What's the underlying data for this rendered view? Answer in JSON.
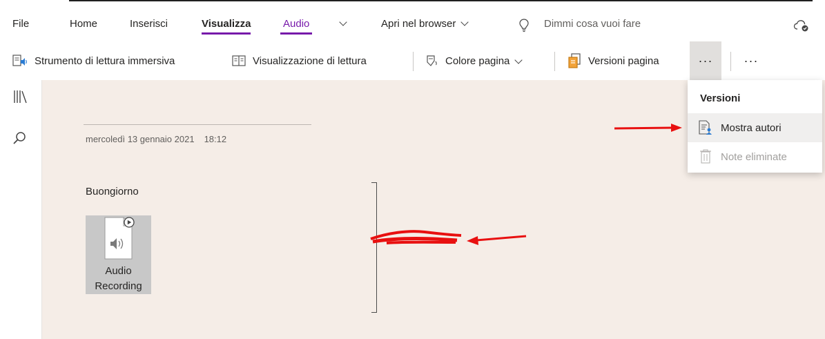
{
  "menu_tabs": {
    "file": "File",
    "home": "Home",
    "insert": "Inserisci",
    "view": "Visualizza",
    "audio": "Audio",
    "open_in_browser": "Apri nel browser",
    "tell_me": "Dimmi cosa vuoi fare"
  },
  "ribbon": {
    "immersive_reader": "Strumento di lettura immersiva",
    "reading_view": "Visualizzazione di lettura",
    "page_color": "Colore pagina",
    "page_versions": "Versioni pagina",
    "more_pressed": "···",
    "more": "···"
  },
  "page": {
    "date": "mercoledì 13 gennaio 2021",
    "time": "18:12",
    "text": "Buongiorno",
    "audio_attachment": {
      "line1": "Audio",
      "line2": "Recording"
    }
  },
  "versions_menu": {
    "header": "Versioni",
    "show_authors": "Mostra autori",
    "deleted_notes": "Note eliminate"
  },
  "colors": {
    "accent": "#7719aa",
    "canvas": "#f5ede7",
    "annotation": "#e81010"
  }
}
